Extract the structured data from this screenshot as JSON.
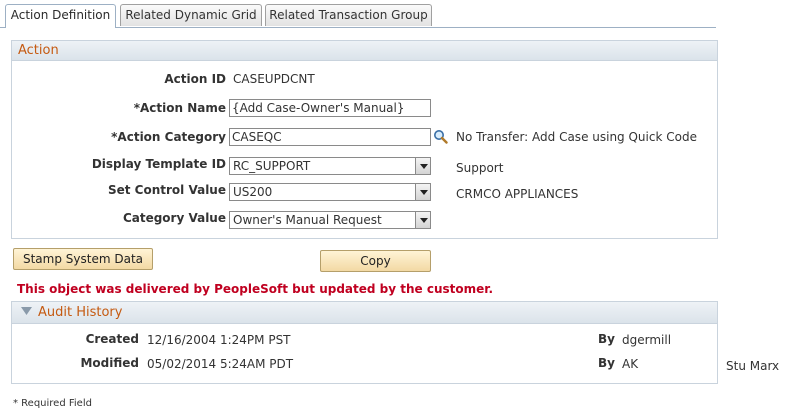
{
  "tabs": [
    {
      "label": "Action Definition",
      "active": true
    },
    {
      "label": "Related Dynamic Grid",
      "active": false
    },
    {
      "label": "Related Transaction Group",
      "active": false
    }
  ],
  "action_section": {
    "title": "Action",
    "action_id": {
      "label": "Action ID",
      "value": "CASEUPDCNT"
    },
    "action_name": {
      "label": "*Action Name",
      "value": "{Add Case-Owner's Manual}"
    },
    "action_category": {
      "label": "*Action Category",
      "value": "CASEQC",
      "description": "No Transfer: Add Case using Quick Code",
      "lookup_icon": "magnifier-icon"
    },
    "display_template": {
      "label": "Display Template ID",
      "value": "RC_SUPPORT",
      "description": "Support"
    },
    "set_control": {
      "label": "Set Control Value",
      "value": "US200",
      "description": "CRMCO APPLIANCES"
    },
    "category_value": {
      "label": "Category Value",
      "value": "Owner's Manual Request"
    }
  },
  "buttons": {
    "stamp": "Stamp System Data",
    "copy": "Copy"
  },
  "warning": "This object was delivered by PeopleSoft but updated by the customer.",
  "audit": {
    "title": "Audit History",
    "created": {
      "label": "Created",
      "value": "12/16/2004  1:24PM PST",
      "by_label": "By",
      "by_value": "dgermill"
    },
    "modified": {
      "label": "Modified",
      "value": "05/02/2014  5:24AM PDT",
      "by_label": "By",
      "by_value": "AK",
      "by_name": "Stu Marx"
    }
  },
  "footer": {
    "required_note": "* Required Field"
  },
  "colors": {
    "section_title": "#c55a11",
    "warning": "#c00020",
    "button_bg": "#f3d9a4"
  }
}
